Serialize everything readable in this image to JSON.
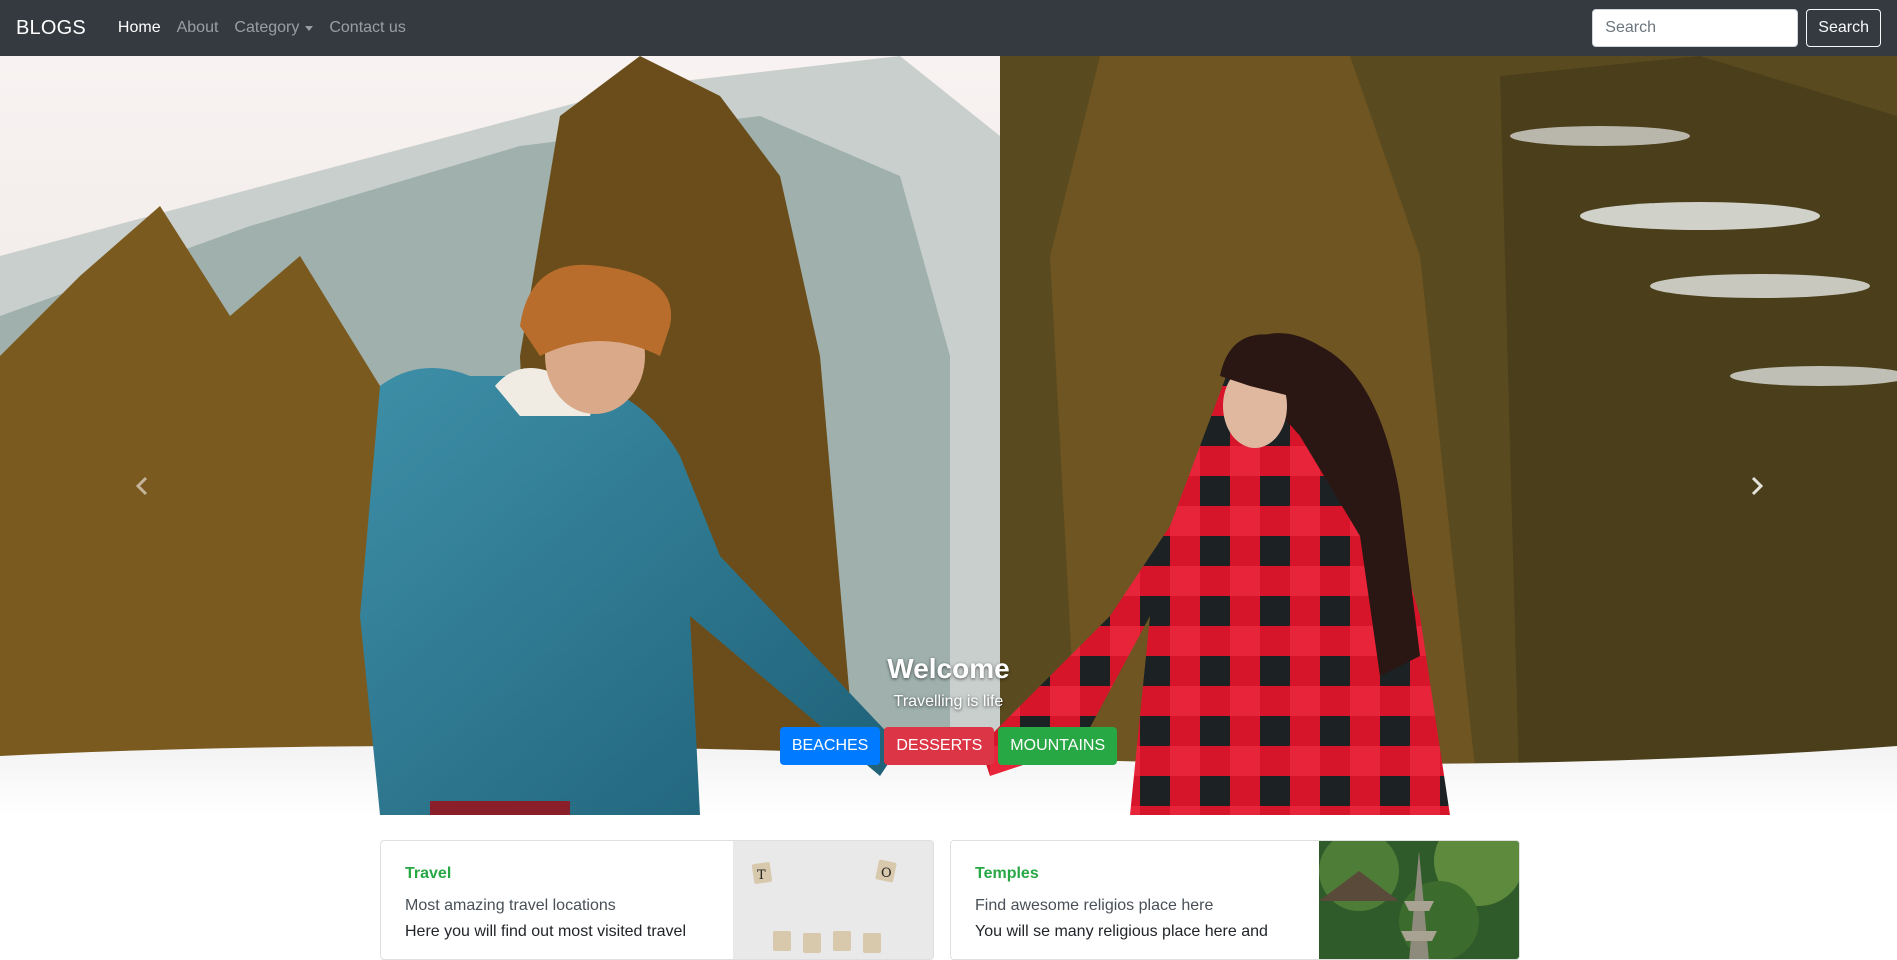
{
  "navbar": {
    "brand": "BLOGS",
    "links": [
      {
        "label": "Home",
        "active": true
      },
      {
        "label": "About"
      },
      {
        "label": "Category",
        "dropdown": true
      },
      {
        "label": "Contact us"
      }
    ],
    "search": {
      "placeholder": "Search",
      "button_label": "Search"
    }
  },
  "hero": {
    "title": "Welcome",
    "subtitle": "Travelling is life",
    "buttons": [
      {
        "label": "BEACHES",
        "color": "#007bff"
      },
      {
        "label": "DESSERTS",
        "color": "#dc3545"
      },
      {
        "label": "MOUNTAINS",
        "color": "#28a745"
      }
    ],
    "prev_icon": "chevron-left-icon",
    "next_icon": "chevron-right-icon"
  },
  "cards": [
    {
      "category": "Travel",
      "title": "Most amazing travel locations",
      "text": "Here you will find out most visited travel"
    },
    {
      "category": "Temples",
      "title": "Find awesome religios place here",
      "text": "You will se many religious place here and"
    }
  ],
  "colors": {
    "navbar_bg": "#343a40",
    "category_green": "#28a745"
  }
}
